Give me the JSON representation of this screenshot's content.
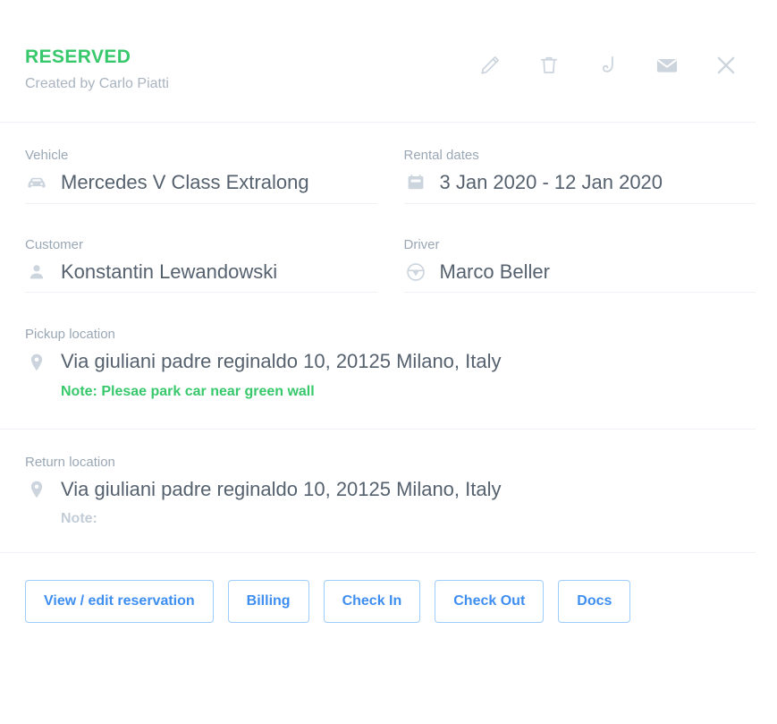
{
  "header": {
    "status": "RESERVED",
    "created_by": "Created by Carlo Piatti",
    "status_color": "#37c86c",
    "actions": [
      {
        "name": "edit-button",
        "icon": "pencil-icon",
        "label": "Edit"
      },
      {
        "name": "delete-button",
        "icon": "trash-icon",
        "label": "Delete"
      },
      {
        "name": "call-button",
        "icon": "phone-icon",
        "label": "Call"
      },
      {
        "name": "email-button",
        "icon": "envelope-icon",
        "label": "Email"
      },
      {
        "name": "close-button",
        "icon": "close-icon",
        "label": "Close"
      }
    ]
  },
  "fields": {
    "vehicle": {
      "label": "Vehicle",
      "value": "Mercedes V Class Extralong",
      "icon": "car-icon"
    },
    "rental_dates": {
      "label": "Rental dates",
      "value": "3 Jan 2020 -  12 Jan 2020",
      "icon": "calendar-icon"
    },
    "customer": {
      "label": "Customer",
      "value": "Konstantin Lewandowski",
      "icon": "person-icon"
    },
    "driver": {
      "label": "Driver",
      "value": "Marco Beller",
      "icon": "steering-wheel-icon"
    }
  },
  "pickup": {
    "label": "Pickup location",
    "address": "Via giuliani padre reginaldo 10, 20125 Milano, Italy",
    "note": "Note: Plesae park car near green wall",
    "note_color": "#37c86c",
    "icon": "map-pin-icon"
  },
  "return": {
    "label": "Return location",
    "address": "Via giuliani padre reginaldo 10, 20125 Milano, Italy",
    "note": "Note:",
    "note_color": "#c3cdd8",
    "icon": "map-pin-icon"
  },
  "buttons": [
    {
      "label": "View / edit reservation",
      "name": "view-edit-reservation-button"
    },
    {
      "label": "Billing",
      "name": "billing-button"
    },
    {
      "label": "Check In",
      "name": "check-in-button"
    },
    {
      "label": "Check Out",
      "name": "check-out-button"
    },
    {
      "label": "Docs",
      "name": "docs-button"
    }
  ],
  "theme": {
    "accent_green": "#37c86c",
    "link_blue": "#3d8ef0",
    "border_blue": "#9ecdfb",
    "text_primary": "#55616e",
    "text_muted": "#9aa7b5",
    "divider": "#eef2f7",
    "icon_gray": "#ccd4dd"
  }
}
